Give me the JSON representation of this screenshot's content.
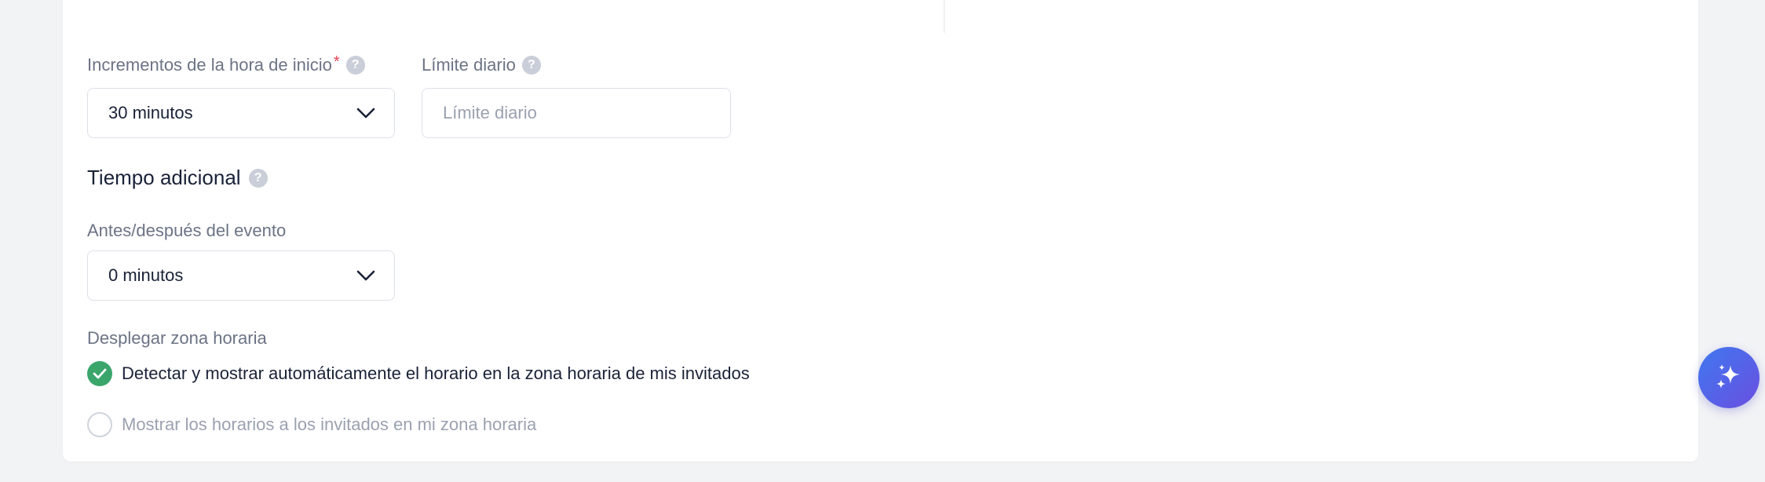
{
  "start_increments": {
    "label": "Incrementos de la hora de inicio",
    "required_mark": "*",
    "help_icon": "?",
    "value": "30 minutos"
  },
  "daily_limit": {
    "label": "Límite diario",
    "help_icon": "?",
    "placeholder": "Límite diario",
    "value": ""
  },
  "buffer_time": {
    "heading": "Tiempo adicional",
    "help_icon": "?",
    "label": "Antes/después del evento",
    "value": "0 minutos"
  },
  "timezone_display": {
    "label": "Desplegar zona horaria",
    "options": [
      {
        "label": "Detectar y mostrar automáticamente el horario en la zona horaria de mis invitados",
        "selected": true
      },
      {
        "label": "Mostrar los horarios a los invitados en mi zona horaria",
        "selected": false
      }
    ]
  },
  "colors": {
    "accent_green": "#3aa66c",
    "required_red": "#e8425b",
    "fab_gradient_start": "#3f78f0",
    "fab_gradient_end": "#6a4fe0"
  },
  "icons": {
    "dropdown": "chevron-down-icon",
    "help": "question-icon",
    "check": "check-icon",
    "ai": "sparkles-icon"
  }
}
